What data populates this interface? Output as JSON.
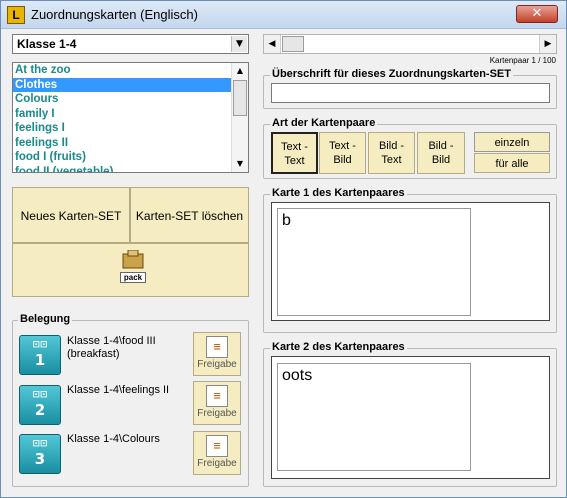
{
  "window": {
    "title": "Zuordnungskarten (Englisch)",
    "close_glyph": "✕",
    "app_icon_letter": "L"
  },
  "class_select": {
    "value": "Klasse 1-4"
  },
  "pair_counter": "Kartenpaar 1 / 100",
  "set_list": {
    "items": [
      "At the zoo",
      "Clothes",
      "Colours",
      "family I",
      "feelings I",
      "feelings II",
      "food I (fruits)",
      "food II (vegetable)"
    ],
    "selected_index": 1
  },
  "actions": {
    "new_set": "Neues Karten-SET",
    "delete_set": "Karten-SET löschen",
    "pack_label": "pack"
  },
  "heading_group": {
    "label": "Überschrift für dieses Zuordnungskarten-SET",
    "value": ""
  },
  "card_type_group": {
    "label": "Art der Kartenpaare",
    "options": [
      {
        "line1": "Text -",
        "line2": "Text"
      },
      {
        "line1": "Text -",
        "line2": "Bild"
      },
      {
        "line1": "Bild -",
        "line2": "Text"
      },
      {
        "line1": "Bild -",
        "line2": "Bild"
      }
    ],
    "active_index": 0,
    "single": "einzeln",
    "all": "für alle"
  },
  "card1": {
    "label": "Karte 1 des Kartenpaares",
    "value": "b"
  },
  "card2": {
    "label": "Karte 2 des Kartenpaares",
    "value": "oots"
  },
  "assignment": {
    "label": "Belegung",
    "slots": [
      {
        "number": "1",
        "text": "Klasse 1-4\\food III (breakfast)",
        "release": "Freigabe"
      },
      {
        "number": "2",
        "text": "Klasse 1-4\\feelings II",
        "release": "Freigabe"
      },
      {
        "number": "3",
        "text": "Klasse 1-4\\Colours",
        "release": "Freigabe"
      }
    ]
  },
  "colors": {
    "list_text": "#1a8a8a",
    "selection": "#3399ff",
    "button_face": "#f5edc1",
    "slot_icon": "#1a8ea2"
  }
}
